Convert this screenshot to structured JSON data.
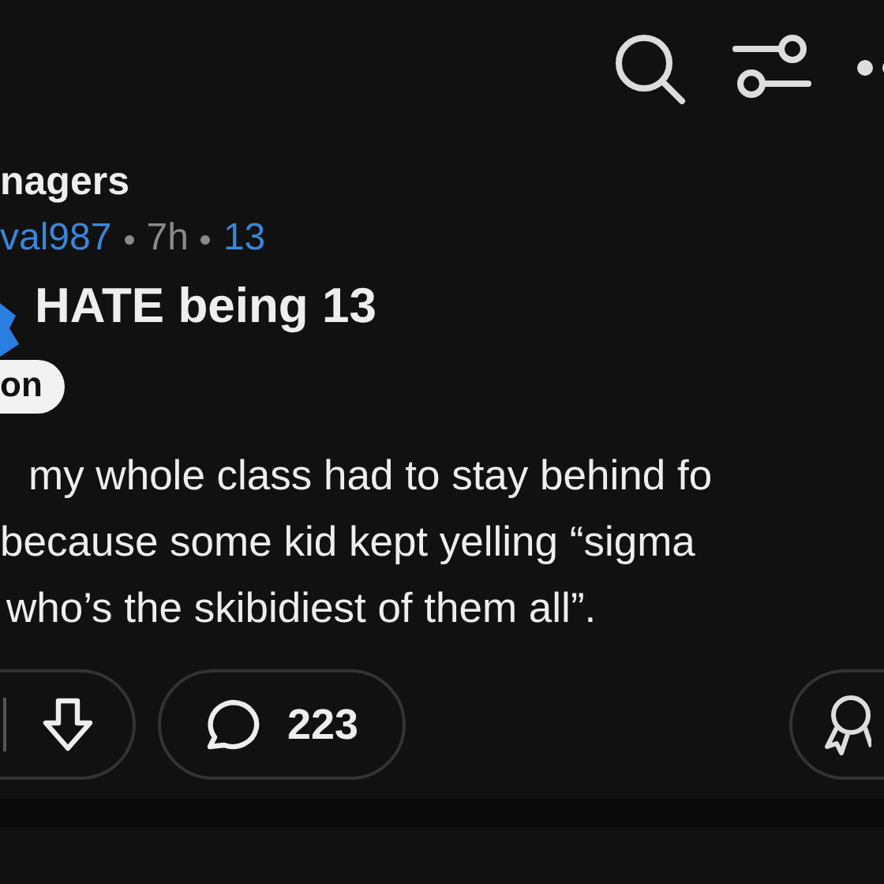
{
  "header": {
    "community": "nagers",
    "author": "val987",
    "age": "7h",
    "flair_count": "13"
  },
  "post": {
    "title": "HATE being 13",
    "flair": "on",
    "body": [
      "my whole class had to stay behind fo",
      "because some kid kept yelling “sigma",
      "who’s the skibidiest of them all”."
    ]
  },
  "actions": {
    "comments": "223"
  }
}
